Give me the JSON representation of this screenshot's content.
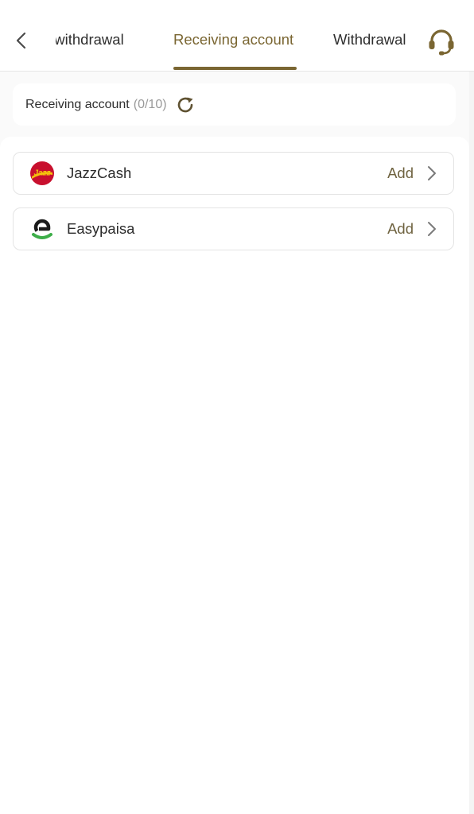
{
  "header": {
    "back_icon": "chevron-left-icon",
    "tabs": [
      {
        "label": "t withdrawal",
        "active": false
      },
      {
        "label": "Receiving account",
        "active": true
      },
      {
        "label": "Withdrawal",
        "active": false
      }
    ],
    "support_icon": "headset-icon"
  },
  "summary": {
    "label": "Receiving account",
    "count": "(0/10)",
    "refresh_icon": "refresh-icon"
  },
  "methods": [
    {
      "name": "JazzCash",
      "action": "Add",
      "logo_icon": "jazzcash-logo-icon"
    },
    {
      "name": "Easypaisa",
      "action": "Add",
      "logo_icon": "easypaisa-logo-icon"
    }
  ],
  "colors": {
    "accent": "#7a6632",
    "add_text": "#6f6340",
    "muted": "#9a9a9a",
    "jazz_red": "#c8102e",
    "jazz_yellow": "#f4c20d",
    "easypaisa_green": "#3dae49",
    "easypaisa_dark": "#1b1b1b"
  }
}
